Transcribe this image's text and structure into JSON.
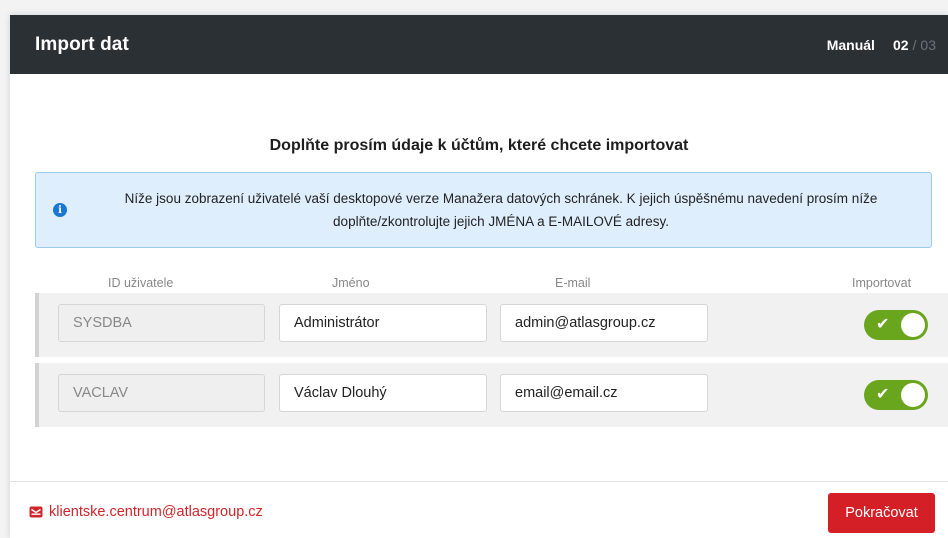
{
  "header": {
    "title": "Import dat",
    "manual_label": "Manuál",
    "step_current": "02",
    "step_separator": "/",
    "step_total": "03"
  },
  "heading": "Doplňte prosím údaje k účtům, které chcete importovat",
  "info": {
    "icon": "info-icon",
    "text": "Níže jsou zobrazení uživatelé vaší desktopové verze Manažera datových schránek. K jejich úspěšnému navedení prosím níže doplňte/zkontrolujte jejich JMÉNA a E-MAILOVÉ adresy."
  },
  "table": {
    "headers": {
      "id": "ID uživatele",
      "name": "Jméno",
      "email": "E-mail",
      "import": "Importovat"
    },
    "rows": [
      {
        "id": "SYSDBA",
        "name": "Administrátor",
        "email": "admin@atlasgroup.cz",
        "import": true
      },
      {
        "id": "VACLAV",
        "name": "Václav Dlouhý",
        "email": "email@email.cz",
        "import": true
      }
    ]
  },
  "footer": {
    "support_email": "klientske.centrum@atlasgroup.cz",
    "continue_label": "Pokračovat"
  },
  "colors": {
    "header_bg": "#2b3035",
    "accent_red": "#d51f26",
    "toggle_on": "#6aa61d",
    "info_bg": "#dfeefd",
    "info_border": "#9ccbf2"
  }
}
